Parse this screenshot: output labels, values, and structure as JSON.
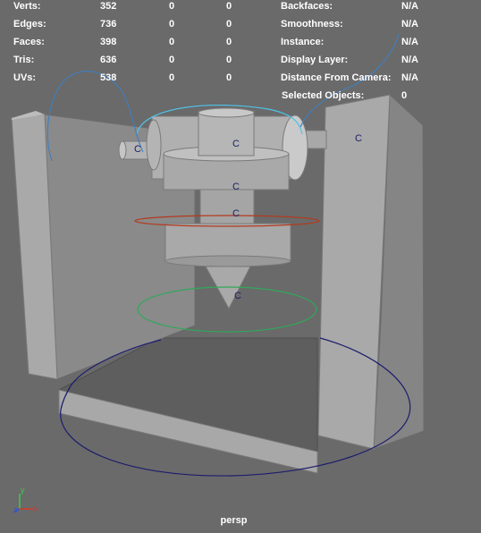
{
  "hud": {
    "left_rows": [
      {
        "label": "Verts:",
        "v1": "352",
        "v2": "0",
        "v3": "0"
      },
      {
        "label": "Edges:",
        "v1": "736",
        "v2": "0",
        "v3": "0"
      },
      {
        "label": "Faces:",
        "v1": "398",
        "v2": "0",
        "v3": "0"
      },
      {
        "label": "Tris:",
        "v1": "636",
        "v2": "0",
        "v3": "0"
      },
      {
        "label": "UVs:",
        "v1": "538",
        "v2": "0",
        "v3": "0"
      }
    ],
    "right_rows": [
      {
        "label": "Backfaces:",
        "value": "N/A"
      },
      {
        "label": "Smoothness:",
        "value": "N/A"
      },
      {
        "label": "Instance:",
        "value": "N/A"
      },
      {
        "label": "Display Layer:",
        "value": "N/A"
      },
      {
        "label": "Distance From Camera:",
        "value": "N/A"
      },
      {
        "label": "Selected Objects:",
        "value": "0"
      }
    ]
  },
  "camera": {
    "name": "persp"
  },
  "axis": {
    "y": "y",
    "x": "x",
    "z": "z"
  },
  "scene": {
    "control_letters": [
      "C",
      "C",
      "C",
      "C",
      "C",
      "C"
    ]
  },
  "colors": {
    "viewport_bg": "#6a6a6a",
    "curve_blue": "#1c1c6e",
    "curve_cyan": "#4fc3e8",
    "curve_red": "#b23a1e",
    "curve_green": "#2fa85a"
  }
}
